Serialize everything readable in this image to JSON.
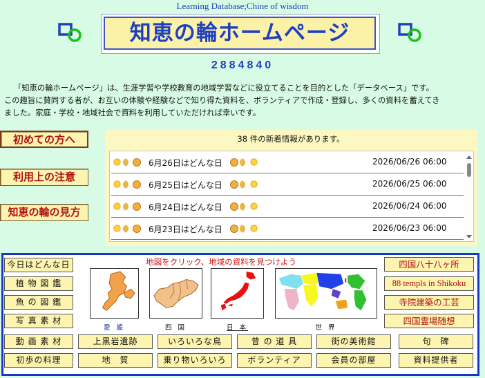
{
  "header": {
    "tagline": "Learning Database;Chine of wisdom",
    "logo_text": "知恵の輪ホームページ",
    "counter": "2884840"
  },
  "intro": {
    "line1": "「知恵の輪ホームページ」は、生涯学習や学校教育の地域学習などに役立てることを目的とした「データベース」です。",
    "line2": "この趣旨に賛同する者が、お互いの体験や経験などで知り得た資料を、ボランティアで作成・登録し、多くの資料を蓄えてき",
    "line3": "ました。家庭・学校・地域社会で資料を利用していただければ幸いです。"
  },
  "left_nav": {
    "first_time": "初めての方へ",
    "notes": "利用上の注意",
    "how_to_view": "知恵の輪の見方"
  },
  "news": {
    "count_text": "38 件の新着情報があります。",
    "items": [
      {
        "title": "6月26日はどんな日",
        "date": "2026/06/26 06:00"
      },
      {
        "title": "6月25日はどんな日",
        "date": "2026/06/25 06:00"
      },
      {
        "title": "6月24日はどんな日",
        "date": "2026/06/24 06:00"
      },
      {
        "title": "6月23日はどんな日",
        "date": "2026/06/23 06:00"
      }
    ]
  },
  "categories_left": {
    "today": "今日はどんな日",
    "plants": "植 物 図 鑑",
    "fish": "魚 の 図 鑑",
    "photos": "写 真 素 材",
    "videos": "動 画 素 材",
    "cooking": "初歩の料理"
  },
  "map": {
    "title": "地図をクリック、地域の資料を見つけよう",
    "ehime": "愛 媛",
    "shikoku": "四 国",
    "japan": "日 本",
    "world": "世 界"
  },
  "right_links": {
    "henro": "四国八十八ヶ所",
    "temples_en": "88 templs in Shikoku",
    "temple_craft": "寺院建築の工芸",
    "spirits": "四国霊場随想"
  },
  "bottom_row1": {
    "b1": "上黒岩遺跡",
    "b2": "いろいろな鳥",
    "b3": "昔 の 道 具",
    "b4": "街の美術館",
    "b5": "句　碑"
  },
  "bottom_row2": {
    "b1": "地　質",
    "b2": "乗り物いろいろ",
    "b3": "ボランティア",
    "b4": "会員の部屋",
    "b5": "資料提供者"
  }
}
